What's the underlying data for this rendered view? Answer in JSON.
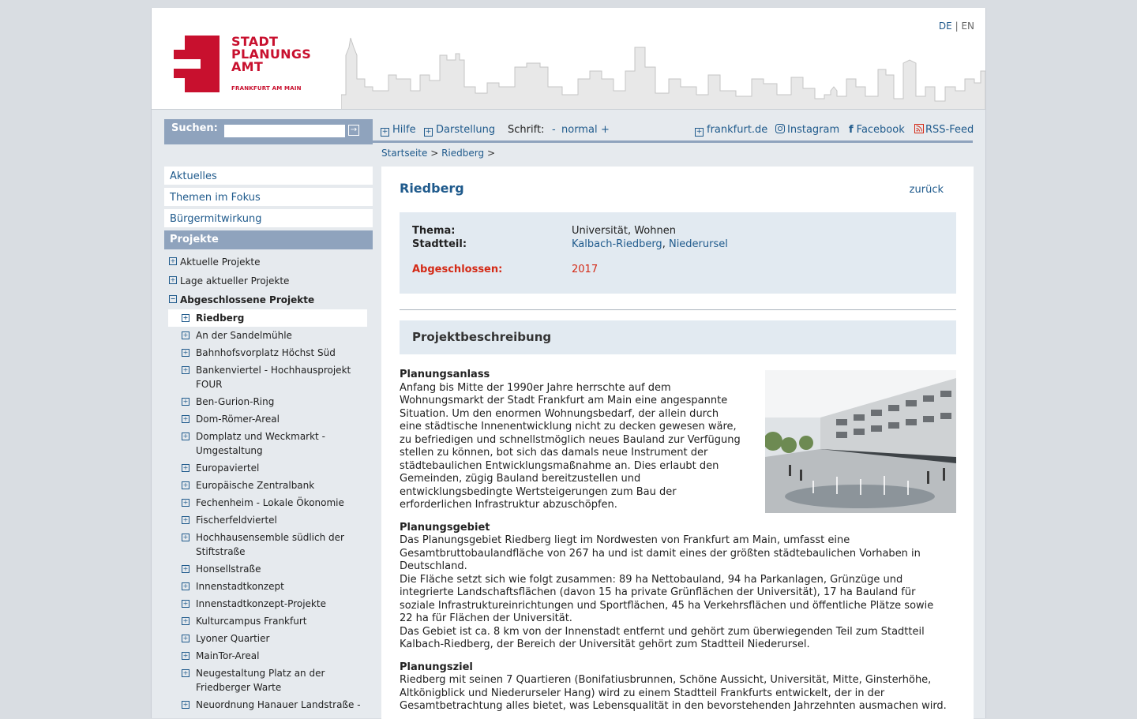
{
  "header": {
    "logo_lines": [
      "STADT",
      "PLANUNGS",
      "AMT"
    ],
    "logo_sub": "FRANKFURT AM MAIN",
    "lang_de": "DE",
    "lang_sep": "|",
    "lang_en": "EN"
  },
  "search": {
    "label": "Suchen:",
    "value": ""
  },
  "toolbar": {
    "help": "Hilfe",
    "display": "Darstellung",
    "font_label": "Schrift:",
    "font_minus": "-",
    "font_normal": "normal",
    "font_plus": "+",
    "frankfurt": "frankfurt.de",
    "instagram": "Instagram",
    "facebook": "Facebook",
    "rss": "RSS-Feed"
  },
  "breadcrumb": {
    "home": "Startseite",
    "sep": ">",
    "current": "Riedberg"
  },
  "sidebar": {
    "top": [
      "Aktuelles",
      "Themen im Fokus",
      "Bürgermitwirkung"
    ],
    "active": "Projekte",
    "sub": [
      "Aktuelle Projekte",
      "Lage aktueller Projekte",
      "Abgeschlossene Projekte"
    ],
    "leaves": [
      "Riedberg",
      "An der Sandelmühle",
      "Bahnhofsvorplatz Höchst Süd",
      "Bankenviertel - Hochhausprojekt FOUR",
      "Ben-Gurion-Ring",
      "Dom-Römer-Areal",
      "Domplatz und Weckmarkt - Umgestaltung",
      "Europaviertel",
      "Europäische Zentralbank",
      "Fechenheim - Lokale Ökonomie",
      "Fischerfeldviertel",
      "Hochhausensemble südlich der Stiftstraße",
      "Honsellstraße",
      "Innenstadtkonzept",
      "Innenstadtkonzept-Projekte",
      "Kulturcampus Frankfurt",
      "Lyoner Quartier",
      "MainTor-Areal",
      "Neugestaltung Platz an der Friedberger Warte",
      "Neuordnung Hanauer Landstraße -"
    ]
  },
  "main": {
    "title": "Riedberg",
    "back": "zurück",
    "facts": {
      "thema_label": "Thema:",
      "thema_value": "Universität, Wohnen",
      "stadtteil_label": "Stadtteil:",
      "stadtteil_link1": "Kalbach-Riedberg",
      "stadtteil_sep": ",",
      "stadtteil_link2": "Niederursel",
      "abgeschlossen_label": "Abgeschlossen:",
      "abgeschlossen_value": "2017"
    },
    "section_title": "Projektbeschreibung",
    "anlass_title": "Planungsanlass",
    "anlass_lines": [
      "Anfang bis Mitte der 1990er Jahre herrschte auf dem",
      "Wohnungsmarkt der Stadt Frankfurt am Main eine angespannte",
      "Situation. Um den enormen Wohnungsbedarf, der allein durch",
      "eine städtische Innenentwicklung nicht zu decken gewesen wäre,",
      "zu befriedigen und schnellstmöglich neues Bauland zur Verfügung",
      "stellen zu können, bot sich das damals neue Instrument der",
      "städtebaulichen Entwicklungsmaßnahme an. Dies erlaubt den",
      "Gemeinden, zügig Bauland bereitzustellen und",
      "entwicklungsbedingte Wertsteigerungen zum Bau der",
      "erforderlichen Infrastruktur abzuschöpfen."
    ],
    "gebiet_title": "Planungsgebiet",
    "gebiet_lines": [
      "Das Planungsgebiet Riedberg liegt im Nordwesten von Frankfurt am Main, umfasst eine",
      "Gesamtbruttobaulandfläche von 267 ha und ist damit eines der größten städtebaulichen Vorhaben in",
      "Deutschland.",
      "Die Fläche setzt sich wie folgt zusammen: 89 ha Nettobauland, 94 ha Parkanlagen, Grünzüge und",
      "integrierte Landschaftsflächen (davon 15 ha private Grünflächen der Universität), 17 ha Bauland für",
      "soziale Infrastruktureinrichtungen und Sportflächen, 45 ha Verkehrsflächen und öffentliche Plätze sowie",
      "22 ha für Flächen der Universität.",
      "Das Gebiet ist ca. 8 km von der Innenstadt entfernt und gehört zum überwiegenden Teil zum Stadtteil",
      "Kalbach-Riedberg, der Bereich der Universität gehört zum Stadtteil Niederursel."
    ],
    "ziel_title": "Planungsziel",
    "ziel_lines": [
      "Riedberg mit seinen 7 Quartieren (Bonifatiusbrunnen, Schöne Aussicht, Universität, Mitte, Ginsterhöhe,",
      "Altkönigblick und Niederurseler Hang) wird zu einem Stadtteil Frankfurts entwickelt, der in der",
      "Gesamtbetrachtung alles bietet, was Lebensqualität in den bevorstehenden Jahrzehnten ausmachen wird."
    ]
  }
}
